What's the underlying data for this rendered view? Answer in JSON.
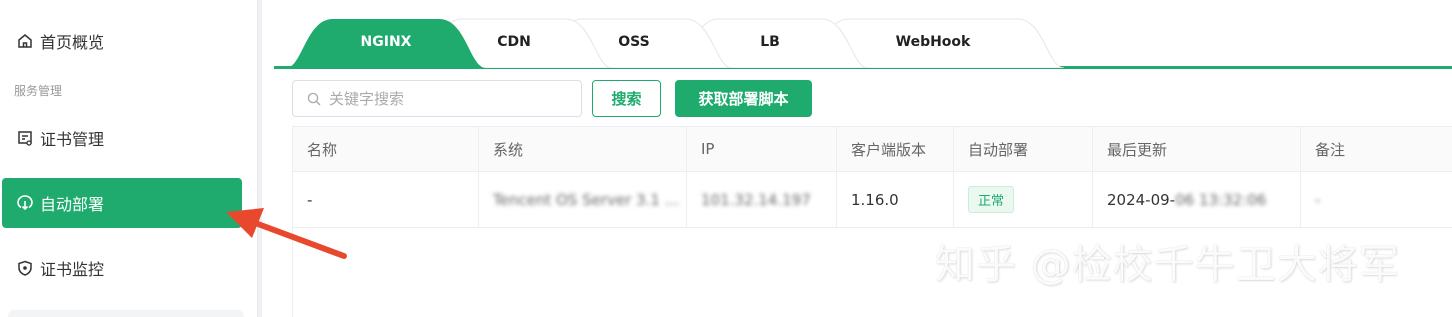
{
  "sidebar": {
    "items": [
      {
        "label": "首页概览",
        "icon": "home-icon"
      },
      {
        "label": "证书管理",
        "icon": "certificate-icon"
      },
      {
        "label": "自动部署",
        "icon": "deploy-icon"
      },
      {
        "label": "证书监控",
        "icon": "shield-icon"
      }
    ],
    "group_label": "服务管理"
  },
  "tabs": [
    {
      "label": "NGINX"
    },
    {
      "label": "CDN"
    },
    {
      "label": "OSS"
    },
    {
      "label": "LB"
    },
    {
      "label": "WebHook"
    }
  ],
  "toolbar": {
    "search_placeholder": "关键字搜索",
    "search_button": "搜索",
    "get_script_button": "获取部署脚本"
  },
  "table": {
    "headers": [
      "名称",
      "系统",
      "IP",
      "客户端版本",
      "自动部署",
      "最后更新",
      "备注"
    ],
    "rows": [
      {
        "name": "-",
        "system": "Tencent OS Server 3.1 ...",
        "ip": "101.32.14.197",
        "client_version": "1.16.0",
        "auto_deploy": "正常",
        "updated": "2024-09-",
        "updated_hidden": "06 13:32:06",
        "note": "-"
      }
    ]
  },
  "watermark": "知乎 @检校千牛卫大将军",
  "colors": {
    "accent": "#1fab6e",
    "arrow": "#e8482e"
  }
}
